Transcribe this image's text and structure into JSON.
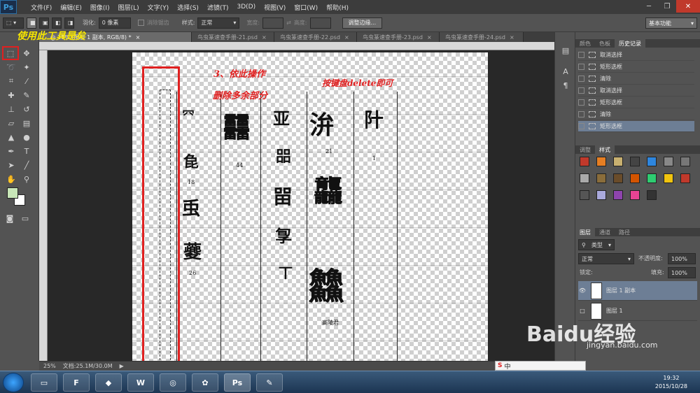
{
  "app": {
    "logo": "Ps"
  },
  "menu": [
    "文件(F)",
    "编辑(E)",
    "图像(I)",
    "图层(L)",
    "文字(Y)",
    "选择(S)",
    "滤镜(T)",
    "3D(D)",
    "视图(V)",
    "窗口(W)",
    "帮助(H)"
  ],
  "options": {
    "feather_label": "羽化:",
    "feather_value": "0 像素",
    "antialias_label": "消除锯齿",
    "style_label": "样式:",
    "style_value": "正常",
    "width_label": "宽度:",
    "height_label": "高度:",
    "refine_edge_button": "调整边缘...",
    "workspace": "基本功能"
  },
  "tabs": [
    {
      "label": "...@ 25% (图层 1 副本, RGB/8) *",
      "active": true
    },
    {
      "label": "鸟虫篆速查手册-21.psd",
      "active": false
    },
    {
      "label": "鸟虫篆速查手册-22.psd",
      "active": false
    },
    {
      "label": "鸟虫篆速查手册-23.psd",
      "active": false
    },
    {
      "label": "鸟虫篆速查手册-24.psd",
      "active": false
    }
  ],
  "annotations": {
    "tool_hint": "使用此工具是矣",
    "step": "3、依此操作",
    "delete_extra": "删除多余部分",
    "press_delete": "按键盘delete即可"
  },
  "glyph_numbers": [
    "44",
    "21",
    "1",
    "18",
    "26"
  ],
  "glyph_caption": "高陵君",
  "status": {
    "zoom": "25%",
    "doc_size": "文档:25.1M/30.0M"
  },
  "panels": {
    "top_tabs": [
      "颜色",
      "色板",
      "历史记录"
    ],
    "history": [
      {
        "label": "取消选择",
        "icon": "history-doc-icon",
        "selected": false
      },
      {
        "label": "矩形选框",
        "icon": "history-marquee-icon",
        "selected": false
      },
      {
        "label": "清除",
        "icon": "history-doc-icon",
        "selected": false
      },
      {
        "label": "取消选择",
        "icon": "history-doc-icon",
        "selected": false
      },
      {
        "label": "矩形选框",
        "icon": "history-marquee-icon",
        "selected": false
      },
      {
        "label": "清除",
        "icon": "history-doc-icon",
        "selected": false
      },
      {
        "label": "矩形选框",
        "icon": "history-marquee-icon",
        "selected": true
      }
    ],
    "mid_tabs": [
      "调整",
      "样式"
    ],
    "layers_tabs": [
      "图层",
      "通道",
      "路径"
    ],
    "filter_type": "类型",
    "blend_mode": "正常",
    "opacity_label": "不透明度:",
    "opacity_value": "100%",
    "lock_label": "锁定:",
    "fill_label": "填充:",
    "fill_value": "100%",
    "layers": [
      {
        "name": "图层 1 副本",
        "visible": true,
        "selected": true
      },
      {
        "name": "图层 1",
        "visible": false,
        "selected": false
      }
    ]
  },
  "watermark": {
    "brand": "Baidu经验",
    "url": "jingyan.baidu.com"
  },
  "ime": {
    "label": "中"
  },
  "taskbar": {
    "time": "19:32",
    "date": "2015/10/28"
  },
  "colors": {
    "foreground": "#c8e6b8",
    "background": "#ffffff",
    "annotation_red": "#e02020",
    "annotation_yellow": "#f7e600"
  }
}
